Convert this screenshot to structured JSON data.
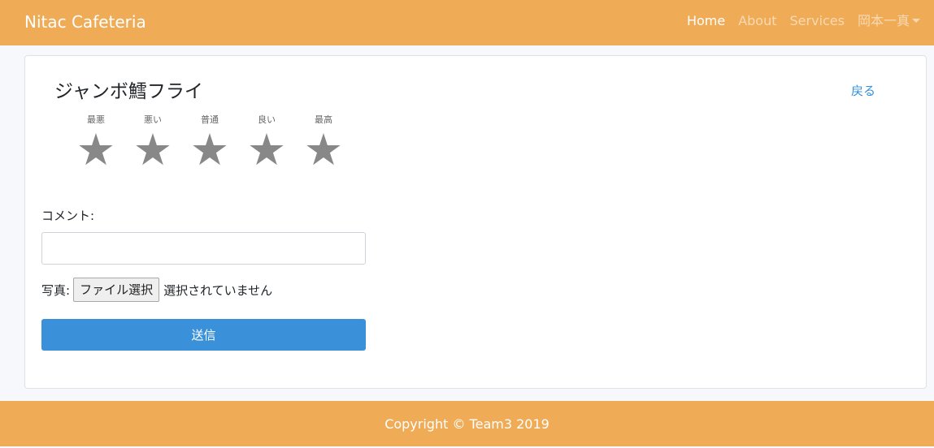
{
  "navbar": {
    "brand": "Nitac Cafeteria",
    "links": [
      {
        "label": "Home"
      },
      {
        "label": "About"
      },
      {
        "label": "Services"
      },
      {
        "label": "岡本一真"
      }
    ]
  },
  "review": {
    "title": "ジャンボ鱈フライ",
    "back_label": "戻る",
    "rating": {
      "labels": [
        "最悪",
        "悪い",
        "普通",
        "良い",
        "最高"
      ],
      "star_glyph": "★",
      "selected": 0
    },
    "comment_label": "コメント:",
    "comment_value": "",
    "photo_label": "写真:",
    "file_button_label": "ファイル選択",
    "file_status": "選択されていません",
    "submit_label": "送信"
  },
  "footer": {
    "text": "Copyright © Team3 2019"
  },
  "colors": {
    "navbar_bg": "#efab55",
    "link_blue": "#3490dc",
    "submit_bg": "#3a91da",
    "star_gray": "#888888"
  }
}
